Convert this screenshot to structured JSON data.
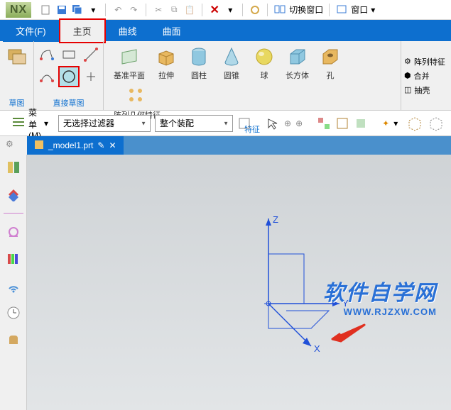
{
  "app": {
    "name": "NX"
  },
  "qat": {
    "switch_window": "切换窗口",
    "window": "窗口"
  },
  "tabs": {
    "file": "文件(F)",
    "home": "主页",
    "curve": "曲线",
    "surface": "曲面"
  },
  "ribbon": {
    "sketch": {
      "label": "草图"
    },
    "direct_sketch": {
      "label": "直接草图"
    },
    "datum_plane": "基准平面",
    "extrude": "拉伸",
    "cylinder": "圆柱",
    "cone": "圆锥",
    "sphere": "球",
    "cuboid": "长方体",
    "hole": "孔",
    "pattern_geom": "阵列几何特征",
    "feature_label": "特征",
    "pattern_feature": "阵列特征",
    "unite": "合并",
    "shell": "抽壳"
  },
  "filter": {
    "menu": "菜单(M)",
    "no_filter": "无选择过滤器",
    "assembly": "整个装配"
  },
  "filetab": {
    "name": "_model1.prt",
    "modified": "✎"
  },
  "watermark": {
    "text": "软件自学网",
    "url": "WWW.RJZXW.COM"
  },
  "axes": {
    "x": "X",
    "y": "Y",
    "z": "Z"
  }
}
